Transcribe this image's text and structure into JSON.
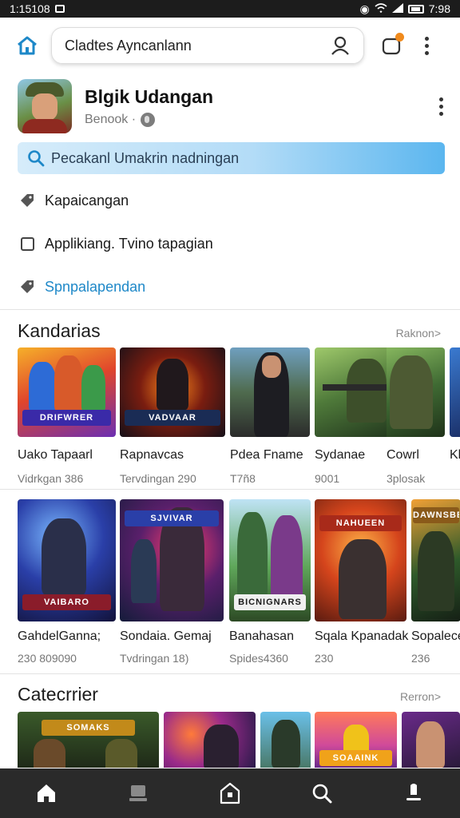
{
  "status_bar": {
    "time_left": "1:15108",
    "time_right": "7:98"
  },
  "top_bar": {
    "search_text": "Cladtes Ayncanlann"
  },
  "profile": {
    "name": "Blgik Udangan",
    "subtitle": "Benook ·"
  },
  "highlight_search": {
    "text": "Pecakanl Umakrin nadningan"
  },
  "menu": {
    "item1": "Kapaicangan",
    "item2": "Applikiang. Tvino tapagian",
    "item3": "Spnpalapendan"
  },
  "section1": {
    "title": "Kandarias",
    "more": "Raknon>",
    "cards": [
      {
        "title": "Uako Tapaarl",
        "sub": "Vidrkgan 386",
        "logo": "DRIFWRER"
      },
      {
        "title": "Rapnavcas",
        "sub": "Tervdingan 290",
        "logo": "VADVAAR"
      },
      {
        "title": "Pdea Fname",
        "sub": "T7ñ8",
        "logo": ""
      },
      {
        "title": "Sydanae",
        "sub": "9001",
        "logo": ""
      },
      {
        "title": "Cowrl",
        "sub": "3plosak",
        "logo": ""
      },
      {
        "title": "Kl",
        "sub": "",
        "logo": ""
      }
    ]
  },
  "section2": {
    "cards": [
      {
        "title": "GahdelGanna;",
        "sub": "230  809090",
        "logo": "VAIBARO"
      },
      {
        "title": "Sondaia. Gemaj",
        "sub": "Tvdringan 18)",
        "logo": "SJVIVAR"
      },
      {
        "title": "Banahasan",
        "sub": "Spides4360",
        "logo": "BICNIGNARS"
      },
      {
        "title": "Sqala Kpanadak",
        "sub": "230",
        "logo": "NAHUEEN"
      },
      {
        "title": "Sopalece",
        "sub": "236",
        "logo": "DAWNSBER"
      }
    ]
  },
  "section3": {
    "title": "Catecrrier",
    "more": "Rerron>",
    "thumb_logos": [
      "SOMAKS",
      "",
      "",
      "SOAAINK",
      ""
    ]
  },
  "colors": {
    "accent": "#1e88c8",
    "notification": "#f08a1c",
    "nav_bg": "#2a2a2a"
  },
  "icons": {
    "top": [
      "home-icon",
      "user-icon",
      "notification-icon",
      "more-icon"
    ],
    "menu": [
      "tag-icon",
      "checkbox-icon",
      "tag-icon"
    ],
    "nav": [
      "home-icon",
      "library-icon",
      "store-icon",
      "search-icon",
      "profile-icon"
    ]
  }
}
